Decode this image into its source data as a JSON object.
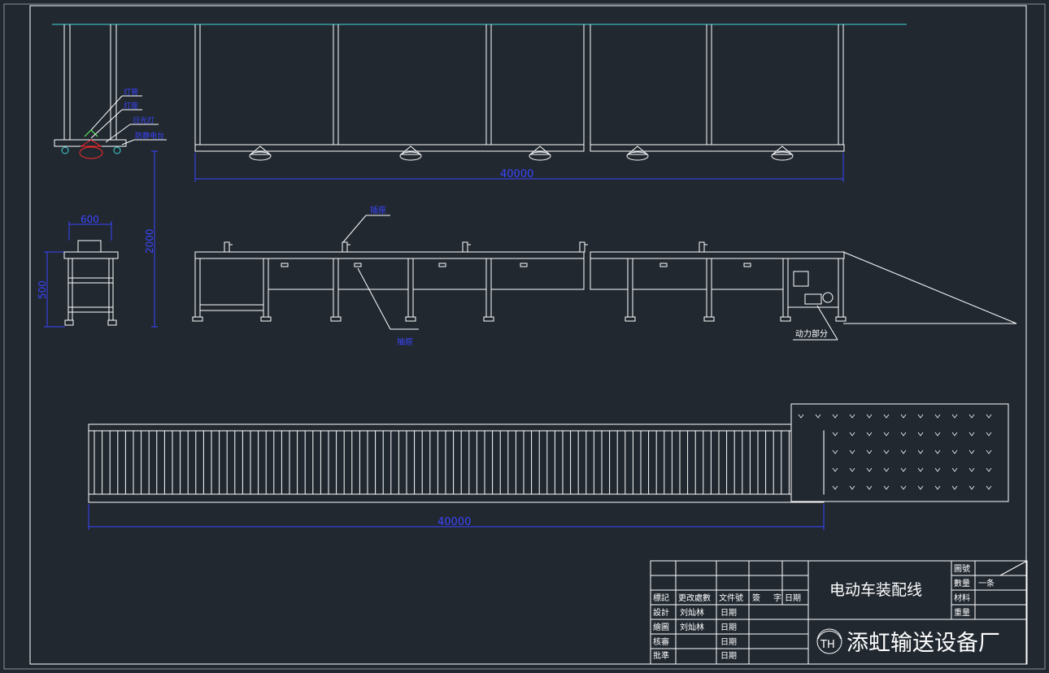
{
  "colors": {
    "background": "#212830",
    "line": "#ffffff",
    "dimension": "#3b45ff",
    "cyan": "#40d8d8",
    "red": "#ff2a2a",
    "green": "#5cff5c"
  },
  "side_view": {
    "labels": {
      "top1": "灯管",
      "top2": "灯座",
      "top3": "日光灯",
      "top4": "防静电台"
    },
    "dim_width": "600",
    "dim_height": "500",
    "dim_total_height": "2000"
  },
  "top_elevation": {
    "dim_length": "40000"
  },
  "front_elevation": {
    "label_socket": "插座",
    "label_drawer": "抽屉",
    "label_power": "动力部分"
  },
  "plan_view": {
    "dim_length": "40000"
  },
  "title_block": {
    "row_headers": [
      "標記",
      "更改處數",
      "文件號",
      "簽",
      "字",
      "日期"
    ],
    "design_label": "設計",
    "design_name": "刘灿林",
    "draw_label": "繪圖",
    "draw_name": "刘灿林",
    "check_label": "核審",
    "approve_label": "批準",
    "date_label": "日期",
    "drawing_title": "电动车装配线",
    "right_labels": [
      "圖號",
      "數量",
      "材料",
      "重量"
    ],
    "quantity_value": "一条",
    "company": "添虹输送设备厂",
    "logo_text": "TH"
  }
}
